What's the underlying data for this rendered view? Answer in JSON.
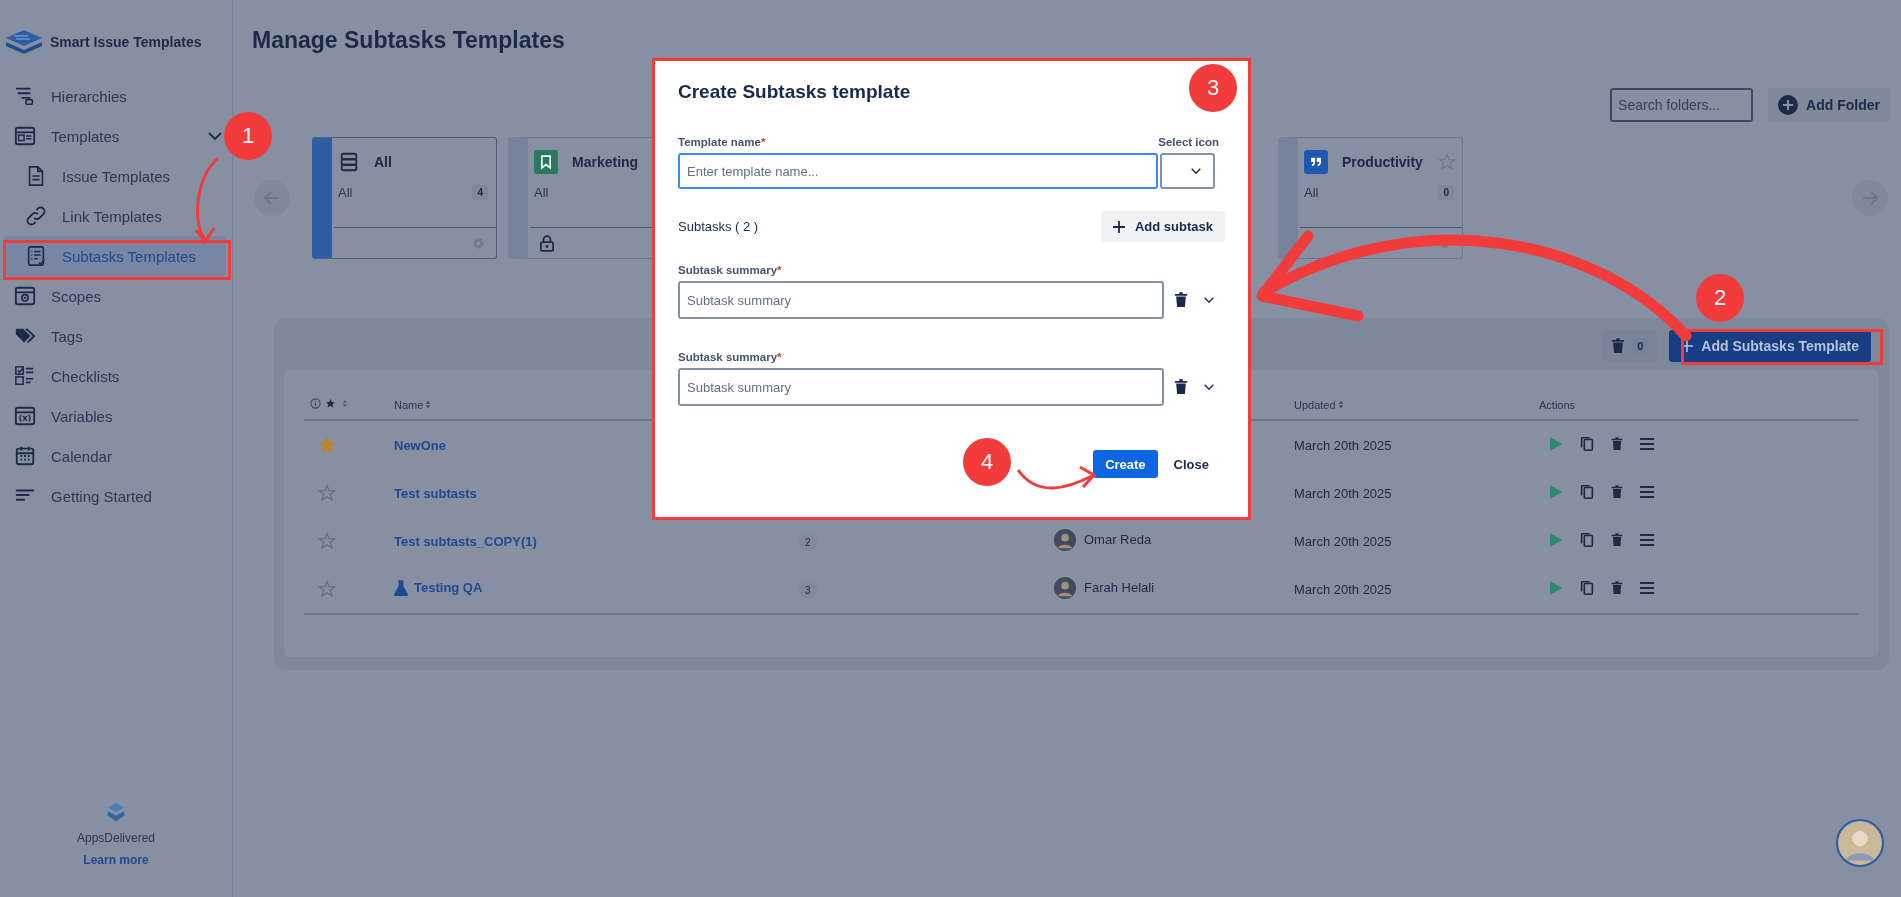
{
  "sidebar": {
    "app_name": "Smart Issue Templates",
    "items": [
      {
        "label": "Hierarchies",
        "selected": false
      },
      {
        "label": "Templates",
        "selected": false,
        "expanded": true,
        "children": [
          {
            "label": "Issue Templates",
            "selected": false
          },
          {
            "label": "Link Templates",
            "selected": false
          },
          {
            "label": "Subtasks Templates",
            "selected": true
          }
        ]
      },
      {
        "label": "Scopes",
        "selected": false
      },
      {
        "label": "Tags",
        "selected": false
      },
      {
        "label": "Checklists",
        "selected": false
      },
      {
        "label": "Variables",
        "selected": false
      },
      {
        "label": "Calendar",
        "selected": false
      },
      {
        "label": "Getting Started",
        "selected": false
      }
    ],
    "vendor": "AppsDelivered",
    "learn_more": "Learn more"
  },
  "page_title": "Manage Subtasks Templates",
  "folder_search": {
    "placeholder": "Search folders..."
  },
  "add_folder": "Add Folder",
  "folders": [
    {
      "name": "All",
      "subtitle": "All",
      "count": "4",
      "selected": true,
      "locked": false
    },
    {
      "name": "Marketing",
      "subtitle": "All",
      "selected": false,
      "locked": true,
      "color": "#2b7a5f"
    },
    {
      "name": "Productivity",
      "subtitle": "All",
      "count": "0",
      "selected": false,
      "locked": false,
      "color": "#2158b3",
      "starred": false
    }
  ],
  "trash_count": "0",
  "add_template": "Add Subtasks Template",
  "table": {
    "columns": [
      "Name",
      "Updated",
      "Actions"
    ],
    "rows": [
      {
        "starred": true,
        "has_icon": false,
        "name": "NewOne",
        "updated": "March 20th 2025"
      },
      {
        "starred": false,
        "has_icon": false,
        "name": "Test subtasts",
        "updated": "March 20th 2025"
      },
      {
        "starred": false,
        "has_icon": false,
        "name": "Test subtasts_COPY(1)",
        "count": "2",
        "author": "Omar Reda",
        "updated": "March 20th 2025"
      },
      {
        "starred": false,
        "has_icon": true,
        "name": "Testing QA",
        "count": "3",
        "author": "Farah Helali",
        "updated": "March 20th 2025"
      }
    ]
  },
  "dialog": {
    "title": "Create Subtasks template",
    "name_label": "Template name",
    "required_mark": "*",
    "name_placeholder": "Enter template name...",
    "icon_label": "Select icon",
    "subtasks_heading": "Subtasks ( 2 )",
    "add_subtask": "Add subtask",
    "subtasks": [
      {
        "label": "Subtask summary",
        "required_mark": "*",
        "placeholder": "Subtask summary"
      },
      {
        "label": "Subtask summary",
        "required_mark": "*",
        "placeholder": "Subtask summary"
      }
    ],
    "create": "Create",
    "close": "Close"
  },
  "annotations": [
    "1",
    "2",
    "3",
    "4"
  ]
}
